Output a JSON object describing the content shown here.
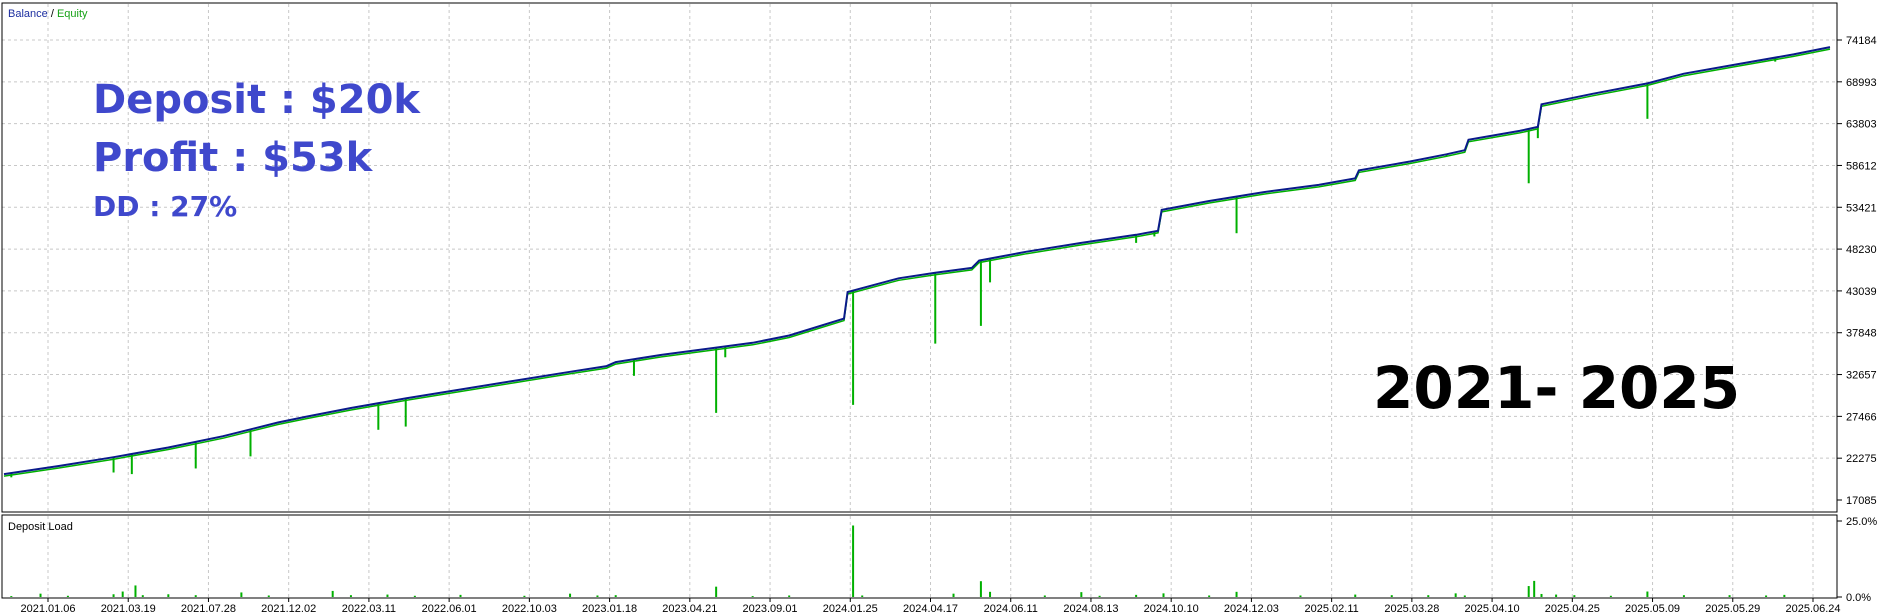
{
  "legend": {
    "balance": "Balance",
    "separator": " / ",
    "equity": "Equity"
  },
  "overlay": {
    "deposit": "Deposit : $20k",
    "profit": "Profit : $53k",
    "drawdown": "DD : 27%",
    "period": "2021- 2025"
  },
  "colors": {
    "balance": "#0a1a8a",
    "equity": "#00b000",
    "legend_balance": "#1c2ea0",
    "legend_equity": "#16a216",
    "overlay_text": "#3f48cc",
    "grid": "#c8c8c8"
  },
  "chart_data": [
    {
      "type": "line",
      "series": [
        {
          "name": "Balance",
          "points": [
            [
              0,
              20300
            ],
            [
              0.03,
              21300
            ],
            [
              0.06,
              22400
            ],
            [
              0.09,
              23600
            ],
            [
              0.12,
              25000
            ],
            [
              0.15,
              26700
            ],
            [
              0.165,
              27400
            ],
            [
              0.19,
              28500
            ],
            [
              0.22,
              29700
            ],
            [
              0.25,
              30800
            ],
            [
              0.28,
              31900
            ],
            [
              0.31,
              33000
            ],
            [
              0.33,
              33700
            ],
            [
              0.335,
              34200
            ],
            [
              0.36,
              35100
            ],
            [
              0.39,
              36000
            ],
            [
              0.41,
              36600
            ],
            [
              0.43,
              37500
            ],
            [
              0.46,
              39600
            ],
            [
              0.462,
              42900
            ],
            [
              0.49,
              44600
            ],
            [
              0.51,
              45300
            ],
            [
              0.53,
              45900
            ],
            [
              0.534,
              46800
            ],
            [
              0.56,
              47900
            ],
            [
              0.59,
              49000
            ],
            [
              0.62,
              50000
            ],
            [
              0.632,
              50500
            ],
            [
              0.634,
              53100
            ],
            [
              0.66,
              54200
            ],
            [
              0.69,
              55300
            ],
            [
              0.72,
              56200
            ],
            [
              0.74,
              57000
            ],
            [
              0.742,
              58000
            ],
            [
              0.77,
              59100
            ],
            [
              0.79,
              60000
            ],
            [
              0.8,
              60500
            ],
            [
              0.802,
              61800
            ],
            [
              0.83,
              62900
            ],
            [
              0.84,
              63400
            ],
            [
              0.842,
              66200
            ],
            [
              0.87,
              67500
            ],
            [
              0.9,
              68800
            ],
            [
              0.92,
              70000
            ],
            [
              0.95,
              71200
            ],
            [
              0.98,
              72400
            ],
            [
              1.0,
              73300
            ]
          ]
        },
        {
          "name": "Equity",
          "drops": [
            [
              0.004,
              19900
            ],
            [
              0.06,
              20500
            ],
            [
              0.07,
              20300
            ],
            [
              0.105,
              21000
            ],
            [
              0.135,
              22500
            ],
            [
              0.205,
              25800
            ],
            [
              0.22,
              26200
            ],
            [
              0.345,
              32500
            ],
            [
              0.39,
              27900
            ],
            [
              0.395,
              34800
            ],
            [
              0.465,
              28900
            ],
            [
              0.51,
              36500
            ],
            [
              0.535,
              38700
            ],
            [
              0.54,
              44100
            ],
            [
              0.62,
              49000
            ],
            [
              0.63,
              49800
            ],
            [
              0.675,
              50200
            ],
            [
              0.79,
              59800
            ],
            [
              0.835,
              56400
            ],
            [
              0.84,
              62000
            ],
            [
              0.9,
              64400
            ],
            [
              0.97,
              71500
            ]
          ]
        }
      ],
      "ylim": [
        17085,
        74184
      ],
      "y_ticks": [
        "74184",
        "68993",
        "63803",
        "58612",
        "53421",
        "48230",
        "43039",
        "37848",
        "32657",
        "27466",
        "22275",
        "17085"
      ],
      "x_ticks": [
        "2021.01.06",
        "2021.03.19",
        "2021.07.28",
        "2021.12.02",
        "2022.03.11",
        "2022.06.01",
        "2022.10.03",
        "2023.01.18",
        "2023.04.21",
        "2023.09.01",
        "2024.01.25",
        "2024.04.17",
        "2024.06.11",
        "2024.08.13",
        "2024.10.10",
        "2024.12.03",
        "2025.02.11",
        "2025.03.28",
        "2025.04.10",
        "2025.04.25",
        "2025.05.09",
        "2025.05.29",
        "2025.06.24"
      ],
      "grid": true
    },
    {
      "type": "bar",
      "title": "Deposit Load",
      "ylim": [
        0,
        25
      ],
      "y_ticks": [
        "25.0%",
        "0.0%"
      ],
      "bars": [
        [
          0.004,
          0.3
        ],
        [
          0.02,
          1.1
        ],
        [
          0.035,
          0.4
        ],
        [
          0.06,
          0.9
        ],
        [
          0.065,
          1.8
        ],
        [
          0.072,
          3.8
        ],
        [
          0.076,
          0.6
        ],
        [
          0.09,
          0.9
        ],
        [
          0.105,
          0.6
        ],
        [
          0.13,
          1.5
        ],
        [
          0.145,
          0.5
        ],
        [
          0.18,
          2.0
        ],
        [
          0.19,
          0.6
        ],
        [
          0.21,
          0.8
        ],
        [
          0.225,
          0.4
        ],
        [
          0.25,
          0.7
        ],
        [
          0.285,
          0.4
        ],
        [
          0.31,
          1.1
        ],
        [
          0.325,
          0.5
        ],
        [
          0.335,
          0.6
        ],
        [
          0.39,
          3.4
        ],
        [
          0.41,
          0.3
        ],
        [
          0.43,
          0.5
        ],
        [
          0.465,
          23.5
        ],
        [
          0.47,
          0.5
        ],
        [
          0.52,
          1.1
        ],
        [
          0.535,
          5.2
        ],
        [
          0.54,
          1.7
        ],
        [
          0.57,
          0.5
        ],
        [
          0.59,
          1.6
        ],
        [
          0.6,
          0.4
        ],
        [
          0.62,
          0.7
        ],
        [
          0.635,
          1.2
        ],
        [
          0.66,
          0.5
        ],
        [
          0.675,
          1.7
        ],
        [
          0.71,
          0.5
        ],
        [
          0.74,
          0.8
        ],
        [
          0.76,
          0.6
        ],
        [
          0.78,
          0.6
        ],
        [
          0.795,
          1.2
        ],
        [
          0.8,
          0.5
        ],
        [
          0.835,
          3.6
        ],
        [
          0.838,
          5.3
        ],
        [
          0.842,
          1.0
        ],
        [
          0.85,
          0.8
        ],
        [
          0.86,
          0.6
        ],
        [
          0.88,
          0.4
        ],
        [
          0.9,
          1.8
        ],
        [
          0.92,
          0.6
        ],
        [
          0.945,
          0.6
        ],
        [
          0.965,
          0.5
        ],
        [
          0.975,
          0.7
        ]
      ]
    }
  ]
}
